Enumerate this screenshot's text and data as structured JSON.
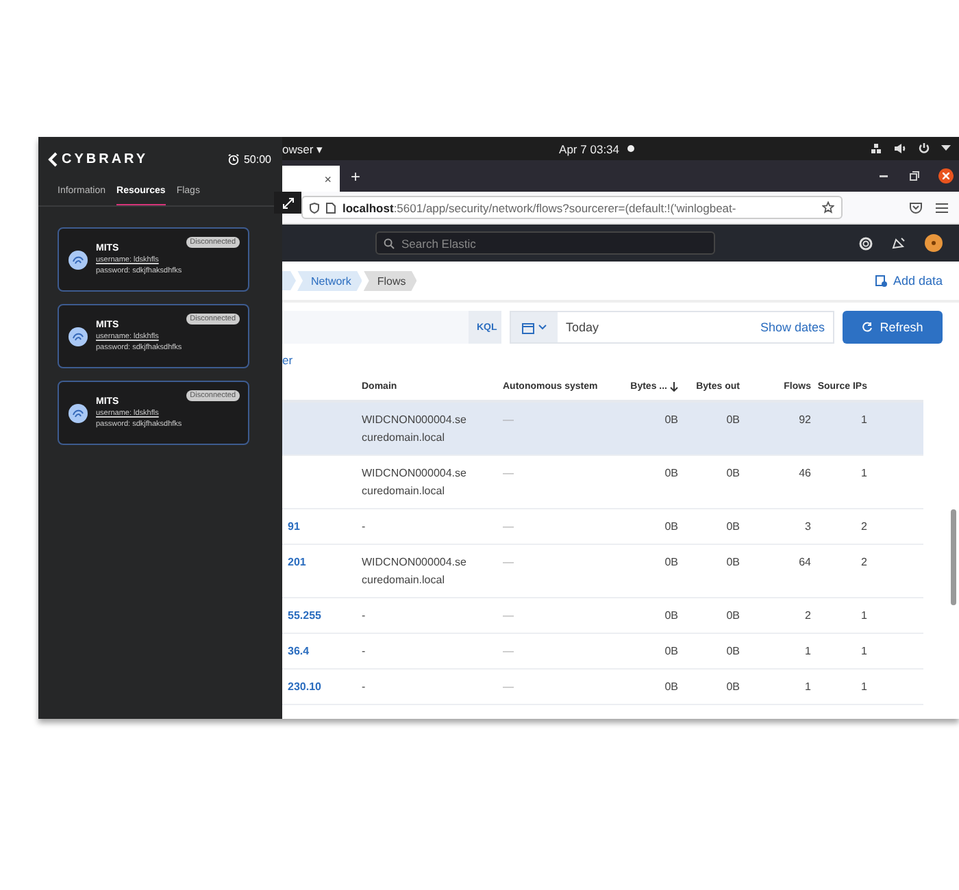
{
  "sidebar": {
    "logo": "CYBRARY",
    "timer": "50:00",
    "tabs": [
      {
        "label": "Information",
        "selected": false
      },
      {
        "label": "Resources",
        "selected": true
      },
      {
        "label": "Flags",
        "selected": false
      }
    ],
    "resources": [
      {
        "name": "MITS",
        "status": "Disconnected",
        "username": "username: ldskhfls",
        "password": "password: sdkjfhaksdhfks"
      },
      {
        "name": "MITS",
        "status": "Disconnected",
        "username": "username: ldskhfls",
        "password": "password: sdkjfhaksdhfks"
      },
      {
        "name": "MITS",
        "status": "Disconnected",
        "username": "username: ldskhfls",
        "password": "password: sdkjfhaksdhfks"
      }
    ]
  },
  "system_bar": {
    "app_menu": "owser ▾",
    "date": "Apr 7",
    "time": "03:34"
  },
  "browser": {
    "tab_close": "×",
    "new_tab": "+",
    "url_host": "localhost",
    "url_path": ":5601/app/security/network/flows?sourcerer=(default:!('winlogbeat-"
  },
  "kibana": {
    "search_placeholder": "Search Elastic",
    "breadcrumbs": [
      {
        "label": "Network",
        "current": false
      },
      {
        "label": "Flows",
        "current": true
      }
    ],
    "add_data": "Add data",
    "query_language": "KQL",
    "date_value": "Today",
    "show_dates": "Show dates",
    "refresh": "Refresh",
    "link_fragment": "er"
  },
  "table": {
    "columns": [
      {
        "label": "Domain",
        "sorted": false
      },
      {
        "label": "Autonomous system",
        "sorted": false
      },
      {
        "label": "Bytes ...",
        "sorted": true
      },
      {
        "label": "Bytes out",
        "sorted": false
      },
      {
        "label": "Flows",
        "sorted": false
      },
      {
        "label": "Source IPs",
        "sorted": false
      }
    ],
    "rows": [
      {
        "highlighted": true,
        "domain": "WIDCNON000004.se curedomain.local",
        "autonomous_system": "—",
        "bytes_in": "0B",
        "bytes_out": "0B",
        "flows": "92",
        "source_ips": "1"
      },
      {
        "highlighted": false,
        "domain": "WIDCNON000004.se curedomain.local",
        "autonomous_system": "—",
        "bytes_in": "0B",
        "bytes_out": "0B",
        "flows": "46",
        "source_ips": "1"
      },
      {
        "highlighted": false,
        "column_1": "91",
        "domain": "-",
        "autonomous_system": "—",
        "bytes_in": "0B",
        "bytes_out": "0B",
        "flows": "3",
        "source_ips": "2"
      },
      {
        "highlighted": false,
        "column_1": "201",
        "domain": "WIDCNON000004.se curedomain.local",
        "autonomous_system": "—",
        "bytes_in": "0B",
        "bytes_out": "0B",
        "flows": "64",
        "source_ips": "2"
      },
      {
        "highlighted": false,
        "column_1": "55.255",
        "domain": "-",
        "autonomous_system": "—",
        "bytes_in": "0B",
        "bytes_out": "0B",
        "flows": "2",
        "source_ips": "1"
      },
      {
        "highlighted": false,
        "column_1": "36.4",
        "domain": "-",
        "autonomous_system": "—",
        "bytes_in": "0B",
        "bytes_out": "0B",
        "flows": "1",
        "source_ips": "1"
      },
      {
        "highlighted": false,
        "column_1": "230.10",
        "domain": "-",
        "autonomous_system": "—",
        "bytes_in": "0B",
        "bytes_out": "0B",
        "flows": "1",
        "source_ips": "1"
      }
    ]
  }
}
